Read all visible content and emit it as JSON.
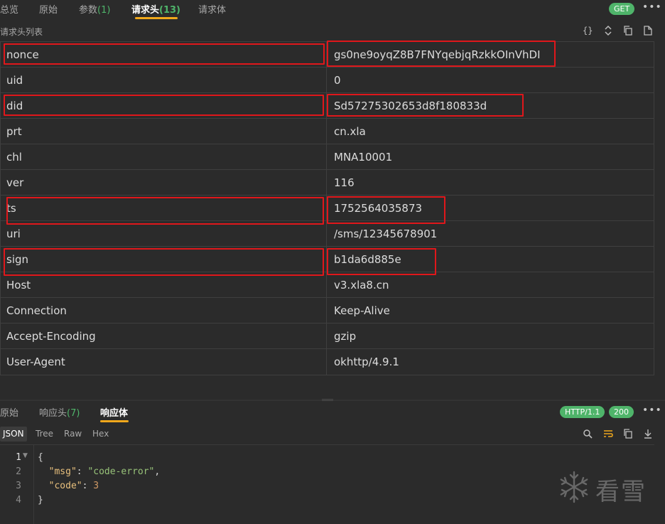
{
  "request_tabs": [
    {
      "label": "总览",
      "count": ""
    },
    {
      "label": "原始",
      "count": ""
    },
    {
      "label": "参数",
      "count": "(1)"
    },
    {
      "label": "请求头",
      "count": "(13)"
    },
    {
      "label": "请求体",
      "count": ""
    }
  ],
  "request_method": "GET",
  "section_label": "请求头列表",
  "toolbar_icons": [
    "braces-icon",
    "sort-icon",
    "copy-icon",
    "file-icon"
  ],
  "headers": [
    {
      "key": "nonce",
      "value": "gs0ne9oyqZ8B7FNYqebjqRzkkOInVhDI"
    },
    {
      "key": "uid",
      "value": "0"
    },
    {
      "key": "did",
      "value": "Sd57275302653d8f180833d"
    },
    {
      "key": "prt",
      "value": "cn.xla"
    },
    {
      "key": "chl",
      "value": "MNA10001"
    },
    {
      "key": "ver",
      "value": "116"
    },
    {
      "key": "ts",
      "value": "1752564035873"
    },
    {
      "key": "uri",
      "value": "/sms/12345678901"
    },
    {
      "key": "sign",
      "value": "b1da6d885e"
    },
    {
      "key": "Host",
      "value": "v3.xla8.cn"
    },
    {
      "key": "Connection",
      "value": "Keep-Alive"
    },
    {
      "key": "Accept-Encoding",
      "value": "gzip"
    },
    {
      "key": "User-Agent",
      "value": "okhttp/4.9.1"
    }
  ],
  "response_tabs": [
    {
      "label": "原始",
      "count": ""
    },
    {
      "label": "响应头",
      "count": "(7)"
    },
    {
      "label": "响应体",
      "count": ""
    }
  ],
  "http_version": "HTTP/1.1",
  "status_code": "200",
  "view_modes": [
    "JSON",
    "Tree",
    "Raw",
    "Hex"
  ],
  "code": {
    "line_numbers": [
      "1",
      "2",
      "3",
      "4"
    ],
    "open_brace": "{",
    "close_brace": "}",
    "msg_key": "\"msg\"",
    "msg_value": "\"code-error\"",
    "code_key": "\"code\"",
    "code_value": "3"
  },
  "watermark": "看雪",
  "colors": {
    "accent": "#f0a81c",
    "badge": "#4fb46a",
    "highlight": "#e0171b",
    "background": "#2b2b2b"
  }
}
